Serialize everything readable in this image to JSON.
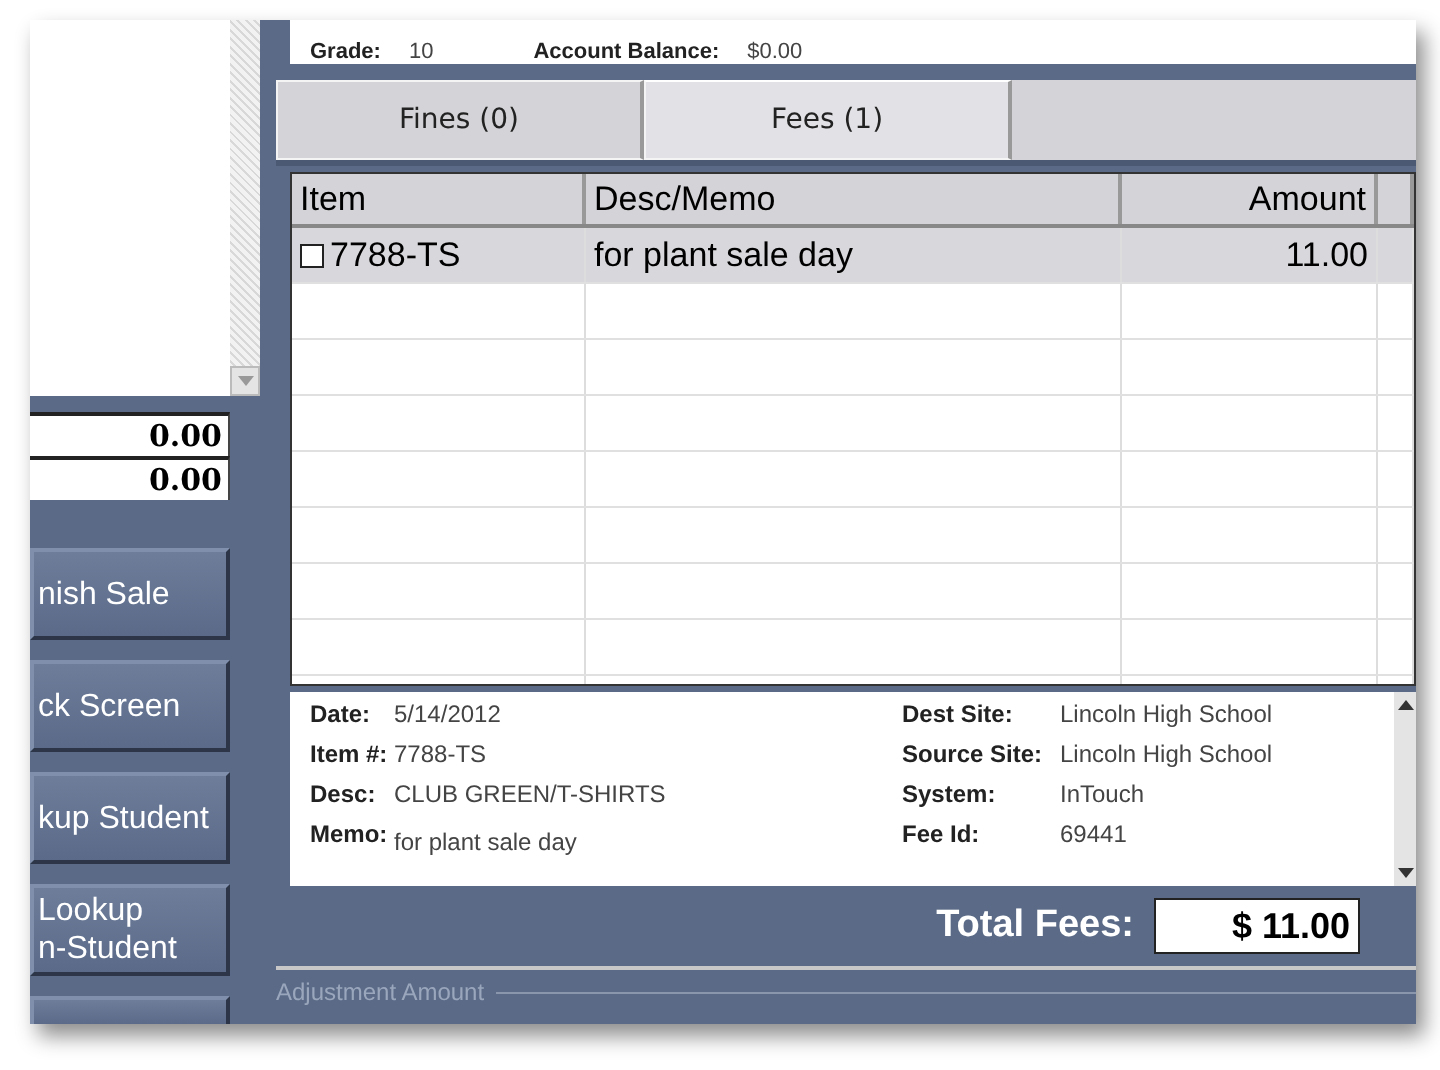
{
  "left_panel": {
    "totals": [
      "0.00",
      "0.00"
    ],
    "buttons": [
      {
        "label": "nish Sale"
      },
      {
        "label": "ck Screen"
      },
      {
        "label": "kup Student"
      },
      {
        "label": "Lookup\nn-Student"
      }
    ]
  },
  "student": {
    "fields": [
      {
        "label": "Grade:",
        "value": "10"
      },
      {
        "label": "Account Balance:",
        "value": "$0.00"
      }
    ]
  },
  "tabs": [
    {
      "label": "Fines (0)",
      "selected": false
    },
    {
      "label": "Fees (1)",
      "selected": true
    }
  ],
  "table": {
    "columns": [
      "Item",
      "Desc/Memo",
      "Amount"
    ],
    "rows": [
      {
        "checked": false,
        "selected": true,
        "cells": [
          "7788-TS",
          "for plant sale day",
          "11.00"
        ]
      }
    ]
  },
  "details": {
    "left": [
      {
        "label": "Date:",
        "value": "5/14/2012"
      },
      {
        "label": "Item #:",
        "value": "7788-TS"
      },
      {
        "label": "Desc:",
        "value": "CLUB GREEN/T-SHIRTS"
      },
      {
        "label": "Memo:",
        "value": "for plant sale day"
      }
    ],
    "right": [
      {
        "label": "Dest Site:",
        "value": "Lincoln High School"
      },
      {
        "label": "Source Site:",
        "value": "Lincoln High School"
      },
      {
        "label": "System:",
        "value": "InTouch"
      },
      {
        "label": "Fee Id:",
        "value": "69441"
      }
    ]
  },
  "total": {
    "label": "Total Fees:",
    "value": "$ 11.00"
  },
  "adjustment": {
    "legend": "Adjustment Amount"
  }
}
